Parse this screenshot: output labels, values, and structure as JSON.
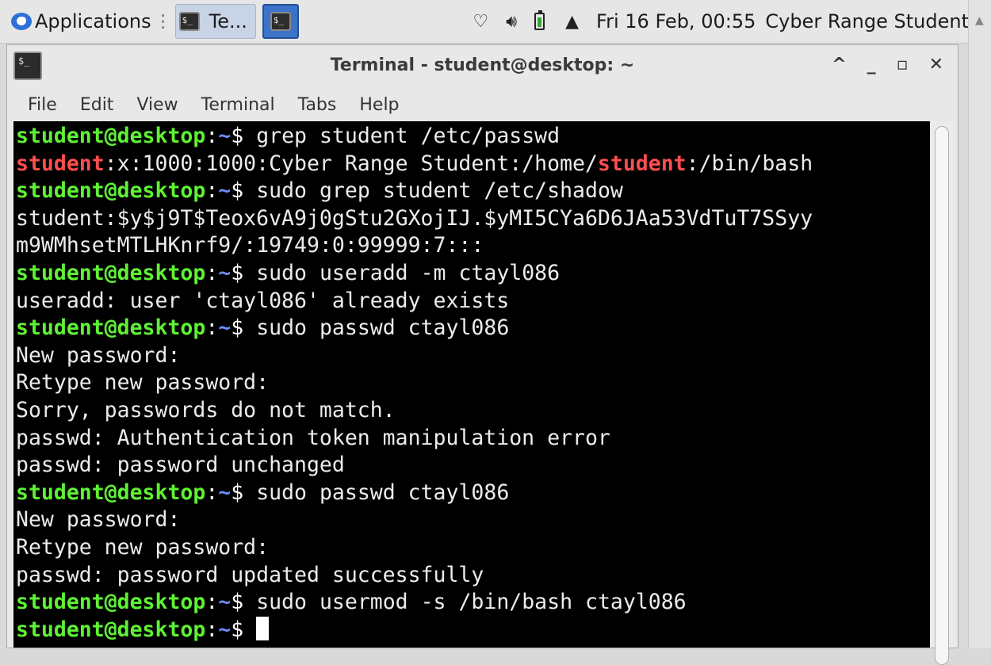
{
  "panel": {
    "applications_label": "Applications",
    "task1_label": "Te...",
    "clock": "Fri 16 Feb, 00:55",
    "user": "Cyber Range Student",
    "icons": [
      "wifi-icon",
      "volume-icon",
      "battery-icon",
      "bell-icon"
    ]
  },
  "window": {
    "title": "Terminal - student@desktop: ~",
    "controls": {
      "maximize": "^",
      "minimize": "_",
      "restore": "▫",
      "close": "✕"
    },
    "menu": [
      "File",
      "Edit",
      "View",
      "Terminal",
      "Tabs",
      "Help"
    ]
  },
  "terminal": {
    "prompt": {
      "user": "student@desktop",
      "colon": ":",
      "dir": "~",
      "sign": "$ "
    },
    "lines": [
      {
        "type": "cmd",
        "text": "grep student /etc/passwd"
      },
      {
        "type": "hl",
        "parts": [
          {
            "t": "student",
            "h": true
          },
          {
            "t": ":x:1000:1000:Cyber Range Student:/home/",
            "h": false
          },
          {
            "t": "student",
            "h": true
          },
          {
            "t": ":/bin/bash",
            "h": false
          }
        ]
      },
      {
        "type": "cmd",
        "text": "sudo grep student /etc/shadow"
      },
      {
        "type": "out",
        "text": "student:$y$j9T$Teox6vA9j0gStu2GXojIJ.$yMI5CYa6D6JAa53VdTuT7SSyy"
      },
      {
        "type": "out",
        "text": "m9WMhsetMTLHKnrf9/:19749:0:99999:7:::"
      },
      {
        "type": "cmd",
        "text": "sudo useradd -m ctayl086"
      },
      {
        "type": "out",
        "text": "useradd: user 'ctayl086' already exists"
      },
      {
        "type": "cmd",
        "text": "sudo passwd ctayl086"
      },
      {
        "type": "out",
        "text": "New password:"
      },
      {
        "type": "out",
        "text": "Retype new password:"
      },
      {
        "type": "out",
        "text": "Sorry, passwords do not match."
      },
      {
        "type": "out",
        "text": "passwd: Authentication token manipulation error"
      },
      {
        "type": "out",
        "text": "passwd: password unchanged"
      },
      {
        "type": "cmd",
        "text": "sudo passwd ctayl086"
      },
      {
        "type": "out",
        "text": "New password:"
      },
      {
        "type": "out",
        "text": "Retype new password:"
      },
      {
        "type": "out",
        "text": "passwd: password updated successfully"
      },
      {
        "type": "cmd",
        "text": "sudo usermod -s /bin/bash ctayl086"
      },
      {
        "type": "cmd",
        "text": "",
        "cursor": true
      }
    ]
  }
}
